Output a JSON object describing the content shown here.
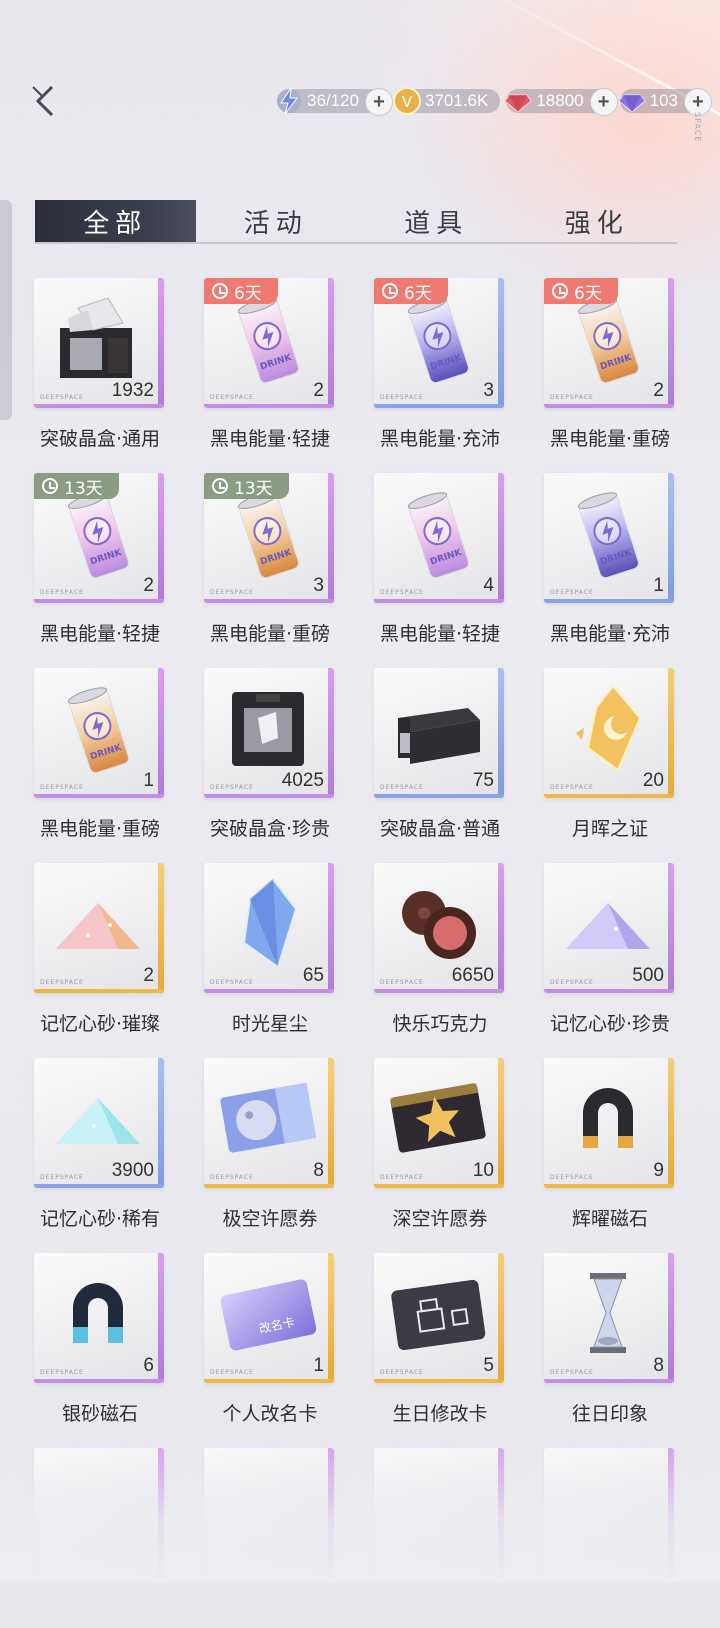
{
  "header": {
    "currencies": [
      {
        "name": "stamina",
        "icon": "lightning-icon",
        "value": "36/120"
      },
      {
        "name": "gold",
        "icon": "gold-coin-icon",
        "value": "3701.6K"
      },
      {
        "name": "red-diamond",
        "icon": "red-diamond-icon",
        "value": "18800"
      },
      {
        "name": "purple-diamond",
        "icon": "purple-diamond-icon",
        "value": "103"
      }
    ],
    "corner_tag": "SPACE"
  },
  "tabs": [
    {
      "label": "全部",
      "active": true
    },
    {
      "label": "活动",
      "active": false
    },
    {
      "label": "道具",
      "active": false
    },
    {
      "label": "强化",
      "active": false
    }
  ],
  "items": [
    {
      "name": "突破晶盒·通用",
      "count": "1932",
      "rarity": "purple",
      "icon": "crystal-box-icon",
      "timer": ""
    },
    {
      "name": "黑电能量·轻捷",
      "count": "2",
      "rarity": "purple",
      "icon": "pink-drink-can-icon",
      "timer": "6天",
      "timer_color": "red"
    },
    {
      "name": "黑电能量·充沛",
      "count": "3",
      "rarity": "blue",
      "icon": "blue-drink-can-icon",
      "timer": "6天",
      "timer_color": "red"
    },
    {
      "name": "黑电能量·重磅",
      "count": "2",
      "rarity": "purple",
      "icon": "orange-drink-can-icon",
      "timer": "6天",
      "timer_color": "red"
    },
    {
      "name": "黑电能量·轻捷",
      "count": "2",
      "rarity": "purple",
      "icon": "pink-drink-can-icon",
      "timer": "13天",
      "timer_color": "green"
    },
    {
      "name": "黑电能量·重磅",
      "count": "3",
      "rarity": "purple",
      "icon": "orange-drink-can-icon",
      "timer": "13天",
      "timer_color": "green"
    },
    {
      "name": "黑电能量·轻捷",
      "count": "4",
      "rarity": "purple",
      "icon": "pink-drink-can-icon",
      "timer": ""
    },
    {
      "name": "黑电能量·充沛",
      "count": "1",
      "rarity": "blue",
      "icon": "blue-drink-can-icon",
      "timer": ""
    },
    {
      "name": "黑电能量·重磅",
      "count": "1",
      "rarity": "purple",
      "icon": "orange-drink-can-icon",
      "timer": ""
    },
    {
      "name": "突破晶盒·珍贵",
      "count": "4025",
      "rarity": "purple",
      "icon": "dark-crystal-box-icon",
      "timer": ""
    },
    {
      "name": "突破晶盒·普通",
      "count": "75",
      "rarity": "blue",
      "icon": "flat-crystal-box-icon",
      "timer": ""
    },
    {
      "name": "月晖之证",
      "count": "20",
      "rarity": "gold",
      "icon": "moon-badge-icon",
      "timer": ""
    },
    {
      "name": "记忆心砂·璀璨",
      "count": "2",
      "rarity": "gold",
      "icon": "gold-sand-icon",
      "timer": ""
    },
    {
      "name": "时光星尘",
      "count": "65",
      "rarity": "purple",
      "icon": "blue-crystal-icon",
      "timer": ""
    },
    {
      "name": "快乐巧克力",
      "count": "6650",
      "rarity": "purple",
      "icon": "chocolate-icon",
      "timer": ""
    },
    {
      "name": "记忆心砂·珍贵",
      "count": "500",
      "rarity": "purple",
      "icon": "purple-sand-icon",
      "timer": ""
    },
    {
      "name": "记忆心砂·稀有",
      "count": "3900",
      "rarity": "blue",
      "icon": "cyan-sand-icon",
      "timer": ""
    },
    {
      "name": "极空许愿券",
      "count": "8",
      "rarity": "gold",
      "icon": "moon-ticket-icon",
      "timer": ""
    },
    {
      "name": "深空许愿券",
      "count": "10",
      "rarity": "gold",
      "icon": "star-ticket-icon",
      "timer": ""
    },
    {
      "name": "辉曜磁石",
      "count": "9",
      "rarity": "gold",
      "icon": "gold-magnet-icon",
      "timer": ""
    },
    {
      "name": "银砂磁石",
      "count": "6",
      "rarity": "purple",
      "icon": "blue-magnet-icon",
      "timer": ""
    },
    {
      "name": "个人改名卡",
      "count": "1",
      "rarity": "gold",
      "icon": "rename-card-icon",
      "timer": ""
    },
    {
      "name": "生日修改卡",
      "count": "5",
      "rarity": "gold",
      "icon": "birthday-card-icon",
      "timer": ""
    },
    {
      "name": "往日印象",
      "count": "8",
      "rarity": "purple",
      "icon": "hourglass-icon",
      "timer": ""
    }
  ],
  "partial_row": 4,
  "card_label": "DEEPSPACE"
}
